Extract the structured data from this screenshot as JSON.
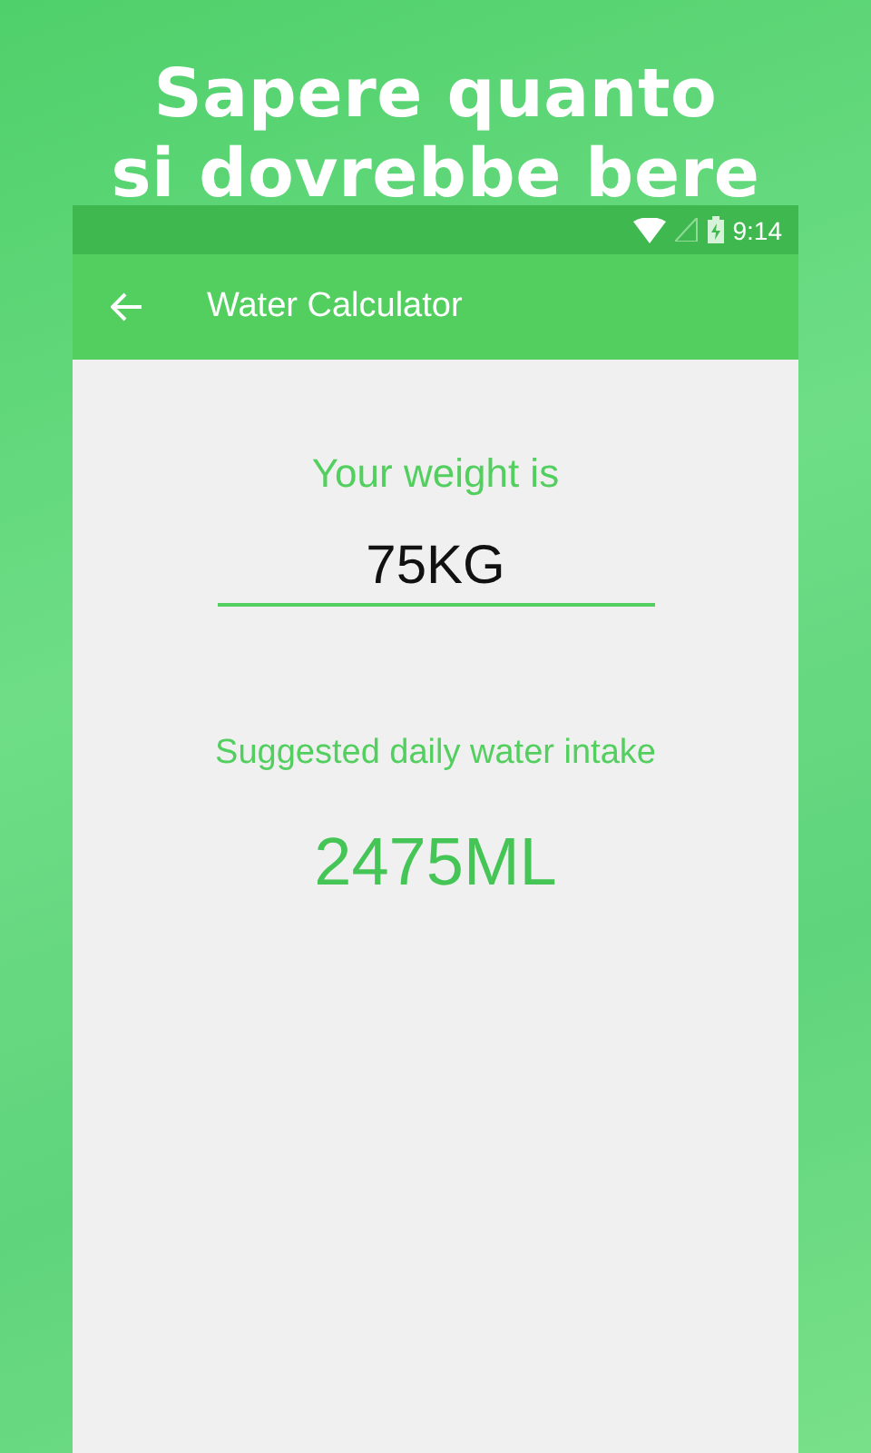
{
  "headline_lines": [
    "Sapere quanto",
    "si dovrebbe bere"
  ],
  "status_bar": {
    "time": "9:14"
  },
  "app_bar": {
    "title": "Water Calculator"
  },
  "weight": {
    "label": "Your weight is",
    "value": "75KG"
  },
  "result": {
    "label": "Suggested daily water intake",
    "value": "2475ML"
  }
}
